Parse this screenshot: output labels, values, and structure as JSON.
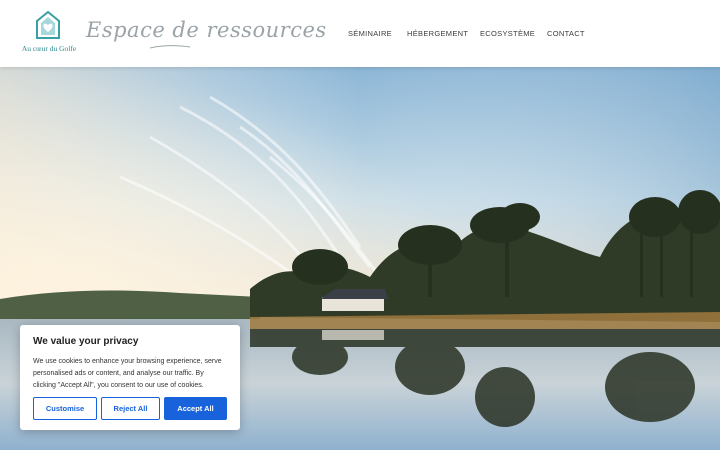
{
  "header": {
    "logo_text": "Au cœur du Golfe",
    "tagline": "Espace de ressources"
  },
  "nav": {
    "items": [
      {
        "label": "SÉMINAIRE"
      },
      {
        "label": "HÉBERGEMENT"
      },
      {
        "label": "ECOSYSTÈME"
      },
      {
        "label": "CONTACT"
      }
    ]
  },
  "hero": {
    "icon": "landscape-photo"
  },
  "cookie_banner": {
    "title": "We value your privacy",
    "body": "We use cookies to enhance your browsing experience, serve personalised ads or content, and analyse our traffic. By clicking \"Accept All\", you consent to our use of cookies.",
    "customise_label": "Customise",
    "reject_label": "Reject All",
    "accept_label": "Accept All"
  },
  "colors": {
    "brand_teal": "#2e8c93",
    "cookie_blue": "#1863dc"
  }
}
